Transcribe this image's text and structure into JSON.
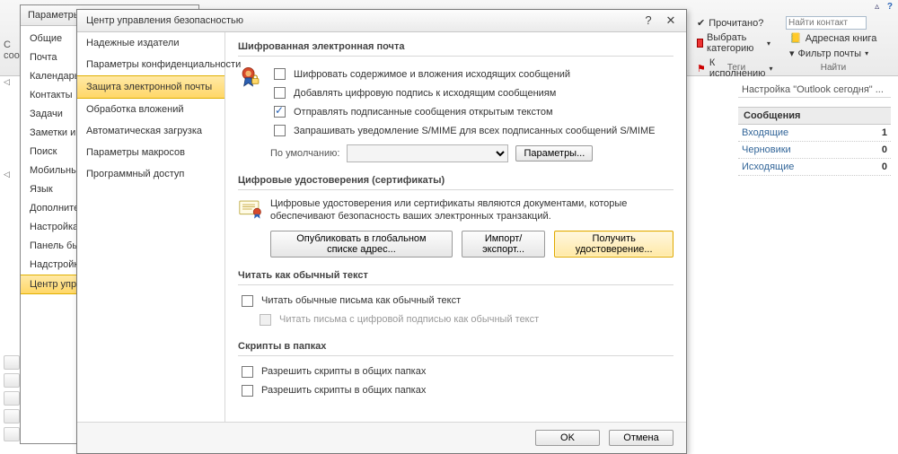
{
  "ribbon": {
    "read": "Прочитано?",
    "category": "Выбрать категорию",
    "followup": "К исполнению",
    "tags_group": "Теги",
    "find_contact": "Найти контакт",
    "addressbook": "Адресная книга",
    "filter": "Фильтр почты",
    "find_group": "Найти"
  },
  "options": {
    "title": "Параметры O...",
    "items": [
      "Общие",
      "Почта",
      "Календарь",
      "Контакты",
      "Задачи",
      "Заметки и д...",
      "Поиск",
      "Мобильные...",
      "Язык",
      "Дополнитель...",
      "Настройка л...",
      "Панель быст...",
      "Надстройки",
      "Центр управ..."
    ],
    "selected_index": 13,
    "left_fragment_top": "С",
    "left_fragment_bottom": "соо"
  },
  "sec": {
    "title": "Центр управления безопасностью",
    "help_tip": "?",
    "close_tip": "✕",
    "nav": [
      "Надежные издатели",
      "Параметры конфиденциальности",
      "Защита электронной почты",
      "Обработка вложений",
      "Автоматическая загрузка",
      "Параметры макросов",
      "Программный доступ"
    ],
    "nav_selected": 2,
    "grp1": {
      "title": "Шифрованная электронная почта",
      "chk1": "Шифровать содержимое и вложения исходящих сообщений",
      "chk2": "Добавлять цифровую подпись к исходящим сообщениям",
      "chk3": "Отправлять подписанные сообщения открытым текстом",
      "chk4": "Запрашивать уведомление S/MIME для всех подписанных сообщений S/MIME",
      "default_label": "По умолчанию:",
      "params_btn": "Параметры..."
    },
    "grp2": {
      "title": "Цифровые удостоверения (сертификаты)",
      "text": "Цифровые удостоверения или сертификаты являются документами, которые обеспечивают безопасность ваших электронных транзакций.",
      "btn_publish": "Опубликовать в глобальном списке адрес...",
      "btn_import": "Импорт/экспорт...",
      "btn_get": "Получить удостоверение..."
    },
    "grp3": {
      "title": "Читать как обычный текст",
      "chk1": "Читать обычные письма как обычный текст",
      "chk2": "Читать письма с цифровой подписью как обычный текст"
    },
    "grp4": {
      "title": "Скрипты в папках",
      "chk1": "Разрешить скрипты в общих папках",
      "chk2": "Разрешить скрипты в общих папках"
    },
    "ok": "OK",
    "cancel": "Отмена"
  },
  "today": {
    "title": "Настройка \"Outlook сегодня\" ...",
    "section": "Сообщения",
    "rows": [
      {
        "label": "Входящие",
        "value": "1"
      },
      {
        "label": "Черновики",
        "value": "0"
      },
      {
        "label": "Исходящие",
        "value": "0"
      }
    ]
  }
}
